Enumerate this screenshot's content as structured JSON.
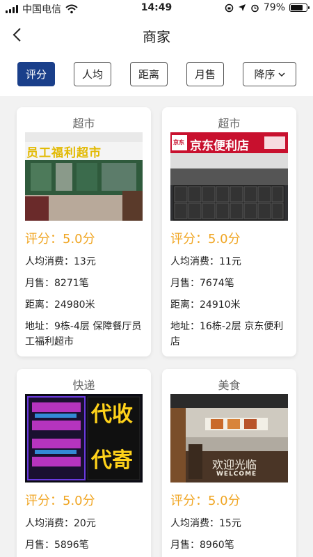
{
  "status": {
    "carrier": "中国电信",
    "time": "14:49",
    "battery": "79%",
    "battery_level": 0.79
  },
  "nav": {
    "title": "商家",
    "back_icon": "back-arrow-icon"
  },
  "filters": [
    {
      "label": "评分",
      "active": true
    },
    {
      "label": "人均",
      "active": false
    },
    {
      "label": "距离",
      "active": false
    },
    {
      "label": "月售",
      "active": false
    },
    {
      "label": "降序",
      "active": false,
      "icon": "chevron-down-icon"
    }
  ],
  "colors": {
    "accent": "#1a3f8a",
    "rating": "#f0a624"
  },
  "cards": [
    {
      "category": "超市",
      "image_sign": "员工福利超市",
      "rating": "评分：5.0分",
      "avg_price": "人均消费：13元",
      "monthly_sales": "月售：8271笔",
      "distance": "距离：24980米",
      "address": "地址：9栋-4层 保障餐厅员工福利超市"
    },
    {
      "category": "超市",
      "image_sign": "京东便利店",
      "image_logo": "京东",
      "rating": "评分：5.0分",
      "avg_price": "人均消费：11元",
      "monthly_sales": "月售：7674笔",
      "distance": "距离：24910米",
      "address": "地址：16栋-2层 京东便利店"
    },
    {
      "category": "快递",
      "image_sign_left": "代收",
      "image_sign_right": "代寄",
      "rating": "评分：5.0分",
      "avg_price": "人均消费：20元",
      "monthly_sales": "月售：5896笔"
    },
    {
      "category": "美食",
      "image_sign": "欢迎光临",
      "image_sign_en": "WELCOME",
      "rating": "评分：5.0分",
      "avg_price": "人均消费：15元",
      "monthly_sales": "月售：8960笔"
    }
  ]
}
